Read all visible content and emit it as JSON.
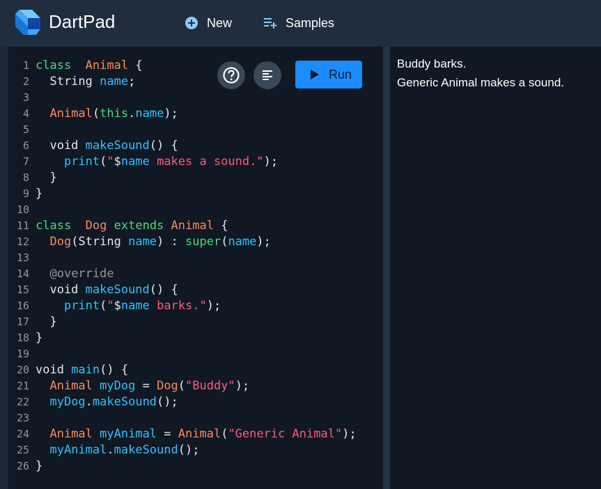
{
  "header": {
    "brand": "DartPad",
    "new_label": "New",
    "samples_label": "Samples"
  },
  "editor": {
    "run_label": "Run",
    "lines": [
      {
        "n": "1",
        "tokens": [
          [
            "kw",
            "class"
          ],
          [
            "",
            "  "
          ],
          [
            "ty",
            "Animal"
          ],
          [
            "",
            " {"
          ]
        ]
      },
      {
        "n": "2",
        "tokens": [
          [
            "",
            "  String "
          ],
          [
            "fn",
            "name"
          ],
          [
            "",
            ";"
          ]
        ]
      },
      {
        "n": "3",
        "tokens": []
      },
      {
        "n": "4",
        "tokens": [
          [
            "",
            "  "
          ],
          [
            "ty",
            "Animal"
          ],
          [
            "",
            "("
          ],
          [
            "kw",
            "this"
          ],
          [
            "",
            "."
          ],
          [
            "fn",
            "name"
          ],
          [
            "",
            ");"
          ]
        ]
      },
      {
        "n": "5",
        "tokens": []
      },
      {
        "n": "6",
        "tokens": [
          [
            "",
            "  void "
          ],
          [
            "fn",
            "makeSound"
          ],
          [
            "",
            "() {"
          ]
        ]
      },
      {
        "n": "7",
        "tokens": [
          [
            "",
            "    "
          ],
          [
            "fn",
            "print"
          ],
          [
            "",
            "("
          ],
          [
            "st",
            "\""
          ],
          [
            "",
            "$"
          ],
          [
            "fn",
            "name"
          ],
          [
            "st",
            " makes a sound.\""
          ],
          [
            "",
            ");"
          ]
        ]
      },
      {
        "n": "8",
        "tokens": [
          [
            "",
            "  }"
          ]
        ]
      },
      {
        "n": "9",
        "tokens": [
          [
            "",
            "}"
          ]
        ]
      },
      {
        "n": "10",
        "tokens": []
      },
      {
        "n": "11",
        "tokens": [
          [
            "kw",
            "class"
          ],
          [
            "",
            "  "
          ],
          [
            "ty",
            "Dog"
          ],
          [
            "",
            " "
          ],
          [
            "kw",
            "extends"
          ],
          [
            "",
            " "
          ],
          [
            "ty",
            "Animal"
          ],
          [
            "",
            " {"
          ]
        ]
      },
      {
        "n": "12",
        "tokens": [
          [
            "",
            "  "
          ],
          [
            "ty",
            "Dog"
          ],
          [
            "",
            "(String "
          ],
          [
            "fn",
            "name"
          ],
          [
            "",
            ") : "
          ],
          [
            "kw",
            "super"
          ],
          [
            "",
            "("
          ],
          [
            "fn",
            "name"
          ],
          [
            "",
            ");"
          ]
        ]
      },
      {
        "n": "13",
        "tokens": []
      },
      {
        "n": "14",
        "tokens": [
          [
            "",
            "  "
          ],
          [
            "an",
            "@override"
          ]
        ]
      },
      {
        "n": "15",
        "tokens": [
          [
            "",
            "  void "
          ],
          [
            "fn",
            "makeSound"
          ],
          [
            "",
            "() {"
          ]
        ]
      },
      {
        "n": "16",
        "tokens": [
          [
            "",
            "    "
          ],
          [
            "fn",
            "print"
          ],
          [
            "",
            "("
          ],
          [
            "st",
            "\""
          ],
          [
            "",
            "$"
          ],
          [
            "fn",
            "name"
          ],
          [
            "st",
            " barks.\""
          ],
          [
            "",
            ");"
          ]
        ]
      },
      {
        "n": "17",
        "tokens": [
          [
            "",
            "  }"
          ]
        ]
      },
      {
        "n": "18",
        "tokens": [
          [
            "",
            "}"
          ]
        ]
      },
      {
        "n": "19",
        "tokens": []
      },
      {
        "n": "20",
        "tokens": [
          [
            "",
            "void "
          ],
          [
            "fn",
            "main"
          ],
          [
            "",
            "() {"
          ]
        ]
      },
      {
        "n": "21",
        "tokens": [
          [
            "",
            "  "
          ],
          [
            "ty",
            "Animal"
          ],
          [
            "",
            " "
          ],
          [
            "fn",
            "myDog"
          ],
          [
            "",
            " = "
          ],
          [
            "ty",
            "Dog"
          ],
          [
            "",
            "("
          ],
          [
            "st",
            "\"Buddy\""
          ],
          [
            "",
            ");"
          ]
        ]
      },
      {
        "n": "22",
        "tokens": [
          [
            "",
            "  "
          ],
          [
            "fn",
            "myDog"
          ],
          [
            "",
            "."
          ],
          [
            "fn",
            "makeSound"
          ],
          [
            "",
            "();"
          ]
        ]
      },
      {
        "n": "23",
        "tokens": []
      },
      {
        "n": "24",
        "tokens": [
          [
            "",
            "  "
          ],
          [
            "ty",
            "Animal"
          ],
          [
            "",
            " "
          ],
          [
            "fn",
            "myAnimal"
          ],
          [
            "",
            " = "
          ],
          [
            "ty",
            "Animal"
          ],
          [
            "",
            "("
          ],
          [
            "st",
            "\"Generic Animal\""
          ],
          [
            "",
            ");"
          ]
        ]
      },
      {
        "n": "25",
        "tokens": [
          [
            "",
            "  "
          ],
          [
            "fn",
            "myAnimal"
          ],
          [
            "",
            "."
          ],
          [
            "fn",
            "makeSound"
          ],
          [
            "",
            "();"
          ]
        ]
      },
      {
        "n": "26",
        "tokens": [
          [
            "",
            "}"
          ]
        ]
      }
    ]
  },
  "output": {
    "lines": [
      "Buddy barks.",
      "Generic Animal makes a sound."
    ]
  },
  "icons": {
    "logo": "dart-logo-icon",
    "new": "add-circle-icon",
    "samples": "playlist-add-icon",
    "help": "help-icon",
    "format": "format-icon",
    "run": "play-icon"
  },
  "colors": {
    "header": "#1f2d3d",
    "editor_bg": "#0f1823",
    "run_button": "#1a8cff",
    "keyword": "#4dd97c",
    "type": "#ff8a5c",
    "function": "#2ec3ff",
    "string": "#ff5b7a"
  }
}
